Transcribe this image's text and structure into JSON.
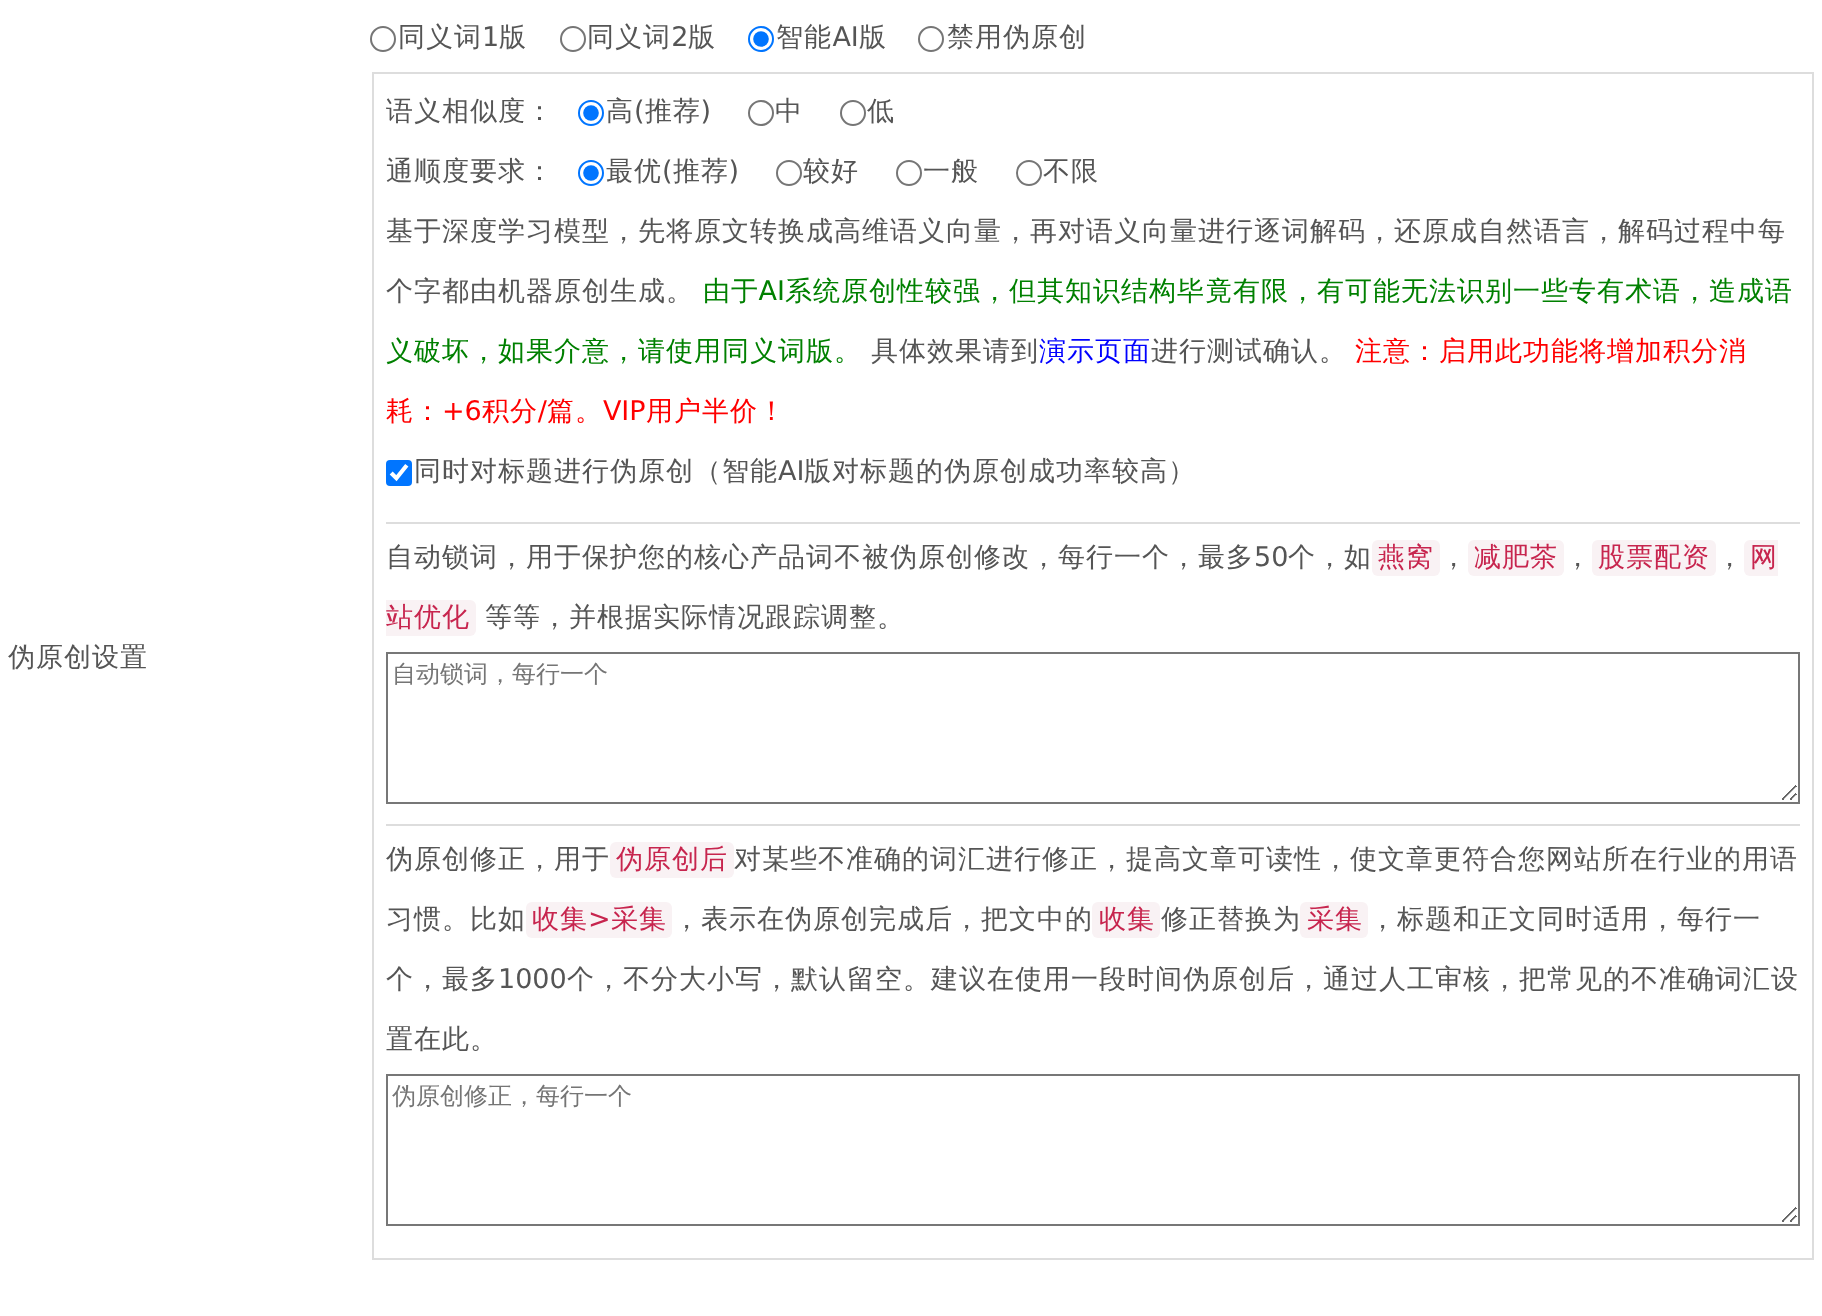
{
  "section_label": "伪原创设置",
  "modes": [
    {
      "label": "同义词1版",
      "selected": false
    },
    {
      "label": "同义词2版",
      "selected": false
    },
    {
      "label": "智能AI版",
      "selected": true
    },
    {
      "label": "禁用伪原创",
      "selected": false
    }
  ],
  "similarity": {
    "label": "语义相似度：",
    "options": [
      {
        "label": "高(推荐)",
        "selected": true
      },
      {
        "label": "中",
        "selected": false
      },
      {
        "label": "低",
        "selected": false
      }
    ]
  },
  "fluency": {
    "label": "通顺度要求：",
    "options": [
      {
        "label": "最优(推荐)",
        "selected": true
      },
      {
        "label": "较好",
        "selected": false
      },
      {
        "label": "一般",
        "selected": false
      },
      {
        "label": "不限",
        "selected": false
      }
    ]
  },
  "ai_description": [
    {
      "kind": "text",
      "text": "基于深度学习模型，先将原文转换成高维语义向量，再对语义向量进行逐词解码，还原成自然语言，解码过程中每个字都由机器原创生成。 "
    },
    {
      "kind": "good",
      "text": "由于AI系统原创性较强，但其知识结构毕竟有限，有可能无法识别一些专有术语，造成语义破坏，如果介意，请使用同义词版。"
    },
    {
      "kind": "text",
      "text": " 具体效果请到"
    },
    {
      "kind": "link",
      "text": "演示页面"
    },
    {
      "kind": "text",
      "text": "进行测试确认。 "
    },
    {
      "kind": "warn",
      "text": "注意：启用此功能将增加积分消耗：+6积分/篇。VIP用户半价！"
    }
  ],
  "title_option": {
    "label": "同时对标题进行伪原创（智能AI版对标题的伪原创成功率较高）",
    "checked": true
  },
  "lock_words": {
    "description": [
      {
        "kind": "text",
        "text": "自动锁词，用于保护您的核心产品词不被伪原创修改，每行一个，最多50个，如"
      },
      {
        "kind": "code",
        "text": "燕窝"
      },
      {
        "kind": "text",
        "text": "，"
      },
      {
        "kind": "code",
        "text": "减肥茶"
      },
      {
        "kind": "text",
        "text": "，"
      },
      {
        "kind": "code",
        "text": "股票配资"
      },
      {
        "kind": "text",
        "text": "，"
      },
      {
        "kind": "code",
        "text": "网站优化"
      },
      {
        "kind": "text",
        "text": " 等等，并根据实际情况跟踪调整。"
      }
    ],
    "placeholder": "自动锁词，每行一个"
  },
  "corrections": {
    "description": [
      {
        "kind": "text",
        "text": "伪原创修正，用于"
      },
      {
        "kind": "code",
        "text": "伪原创后"
      },
      {
        "kind": "text",
        "text": "对某些不准确的词汇进行修正，提高文章可读性，使文章更符合您网站所在行业的用语习惯。比如"
      },
      {
        "kind": "code",
        "text": "收集>采集"
      },
      {
        "kind": "text",
        "text": "，表示在伪原创完成后，把文中的"
      },
      {
        "kind": "code",
        "text": "收集"
      },
      {
        "kind": "text",
        "text": "修正替换为"
      },
      {
        "kind": "code",
        "text": "采集"
      },
      {
        "kind": "text",
        "text": "，标题和正文同时适用，每行一个，最多1000个，不分大小写，默认留空。建议在使用一段时间伪原创后，通过人工审核，把常见的不准确词汇设置在此。"
      }
    ],
    "placeholder": "伪原创修正，每行一个"
  }
}
